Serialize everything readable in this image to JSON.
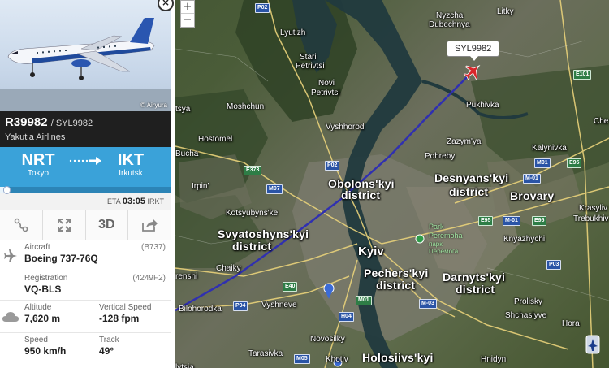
{
  "map": {
    "zoom_in": "+",
    "zoom_out": "−",
    "callsign_tag": "SYL9982",
    "labels": {
      "nyzcha": "Nyzcha",
      "dubechnya": "Dubechnya",
      "litky": "Litky",
      "lyutizh": "Lyutizh",
      "stari_petrivtsi": "Stari",
      "stari_petrivtsi2": "Petrivtsi",
      "novi_petrivtsi": "Novi",
      "novi_petrivtsi2": "Petrivtsi",
      "moshchun": "Moshchun",
      "pukhivka": "Pukhivka",
      "vyshhorod": "Vyshhorod",
      "hostomel": "Hostomel",
      "zazymya": "Zazym'ya",
      "kalynivka": "Kalynivka",
      "bucha": "Bucha",
      "pohreby": "Pohreby",
      "tsya": "tsya",
      "obolon1": "Obolons'kyi",
      "obolon2": "district",
      "desnian1": "Desnyans'kyi",
      "desnian2": "district",
      "brovary": "Brovary",
      "irpin": "Irpin'",
      "kotsiubynske": "Kotsyubyns'ke",
      "sviatoshyn1": "Svyatoshyns'kyi",
      "sviatoshyn2": "district",
      "krasyliv": "Krasyliv",
      "trebukhiv": "Trebukhiv",
      "kniazhychi": "Knyazhychi",
      "park": "Park",
      "park_name": "Peremoha",
      "park_ua1": "парк",
      "park_ua2": "Перемога",
      "kyiv": "Kyiv",
      "chaiky": "Chaiky",
      "renshi": "renshi",
      "pechersk1": "Pechers'kyi",
      "pechersk2": "district",
      "darnytsia1": "Darnyts'kyi",
      "darnytsia2": "district",
      "bilohorodka": "Bilohorodka",
      "vyshneve": "Vyshneve",
      "prolisky": "Prolisky",
      "shchaslyve": "Shchaslyve",
      "hora": "Hora",
      "novosilky": "Novosilky",
      "tarasivka": "Tarasivka",
      "khotiv": "Khotiv",
      "holosiiv1": "Holosiivs'kyi",
      "hnidyn": "Hnidyn",
      "lytsia": "lytsia",
      "chernihiv_frag": "Che"
    },
    "road_shields": {
      "p02_top": "P02",
      "p02_mid": "P02",
      "e101": "E101",
      "e373": "E373",
      "m07": "M07",
      "m01_a": "M01",
      "m01_b": "M01",
      "m01_c": "M-01",
      "e95_a": "E95",
      "e95_b": "E95",
      "e95_c": "E95",
      "p03": "P03",
      "e40": "E40",
      "p04": "P04",
      "h04": "H04",
      "m03": "M-03",
      "m05": "M05",
      "m01_d": "M-01"
    }
  },
  "panel": {
    "close": "×",
    "photo_credit": "© Airyura",
    "registration": "R39982",
    "callsign": "/ SYL9982",
    "airline": "Yakutia Airlines",
    "route": {
      "from_code": "NRT",
      "from_city": "Tokyo",
      "to_code": "IKT",
      "to_city": "Irkutsk",
      "arrow": "·····➜",
      "progress": 0.04
    },
    "eta": {
      "label": "ETA",
      "time": "03:05",
      "tz": "IRKT"
    },
    "toolbar": {
      "view3d": "3D"
    },
    "details": {
      "aircraft_key": "Aircraft",
      "aircraft_code": "(B737)",
      "aircraft_val": "Boeing 737-76Q",
      "registration_key": "Registration",
      "registration_code": "(4249F2)",
      "registration_val": "VQ-BLS",
      "altitude_key": "Altitude",
      "altitude_val": "7,620 m",
      "vspeed_key": "Vertical Speed",
      "vspeed_val": "-128 fpm",
      "speed_key": "Speed",
      "speed_val": "950 km/h",
      "track_key": "Track",
      "track_val": "49°"
    }
  }
}
